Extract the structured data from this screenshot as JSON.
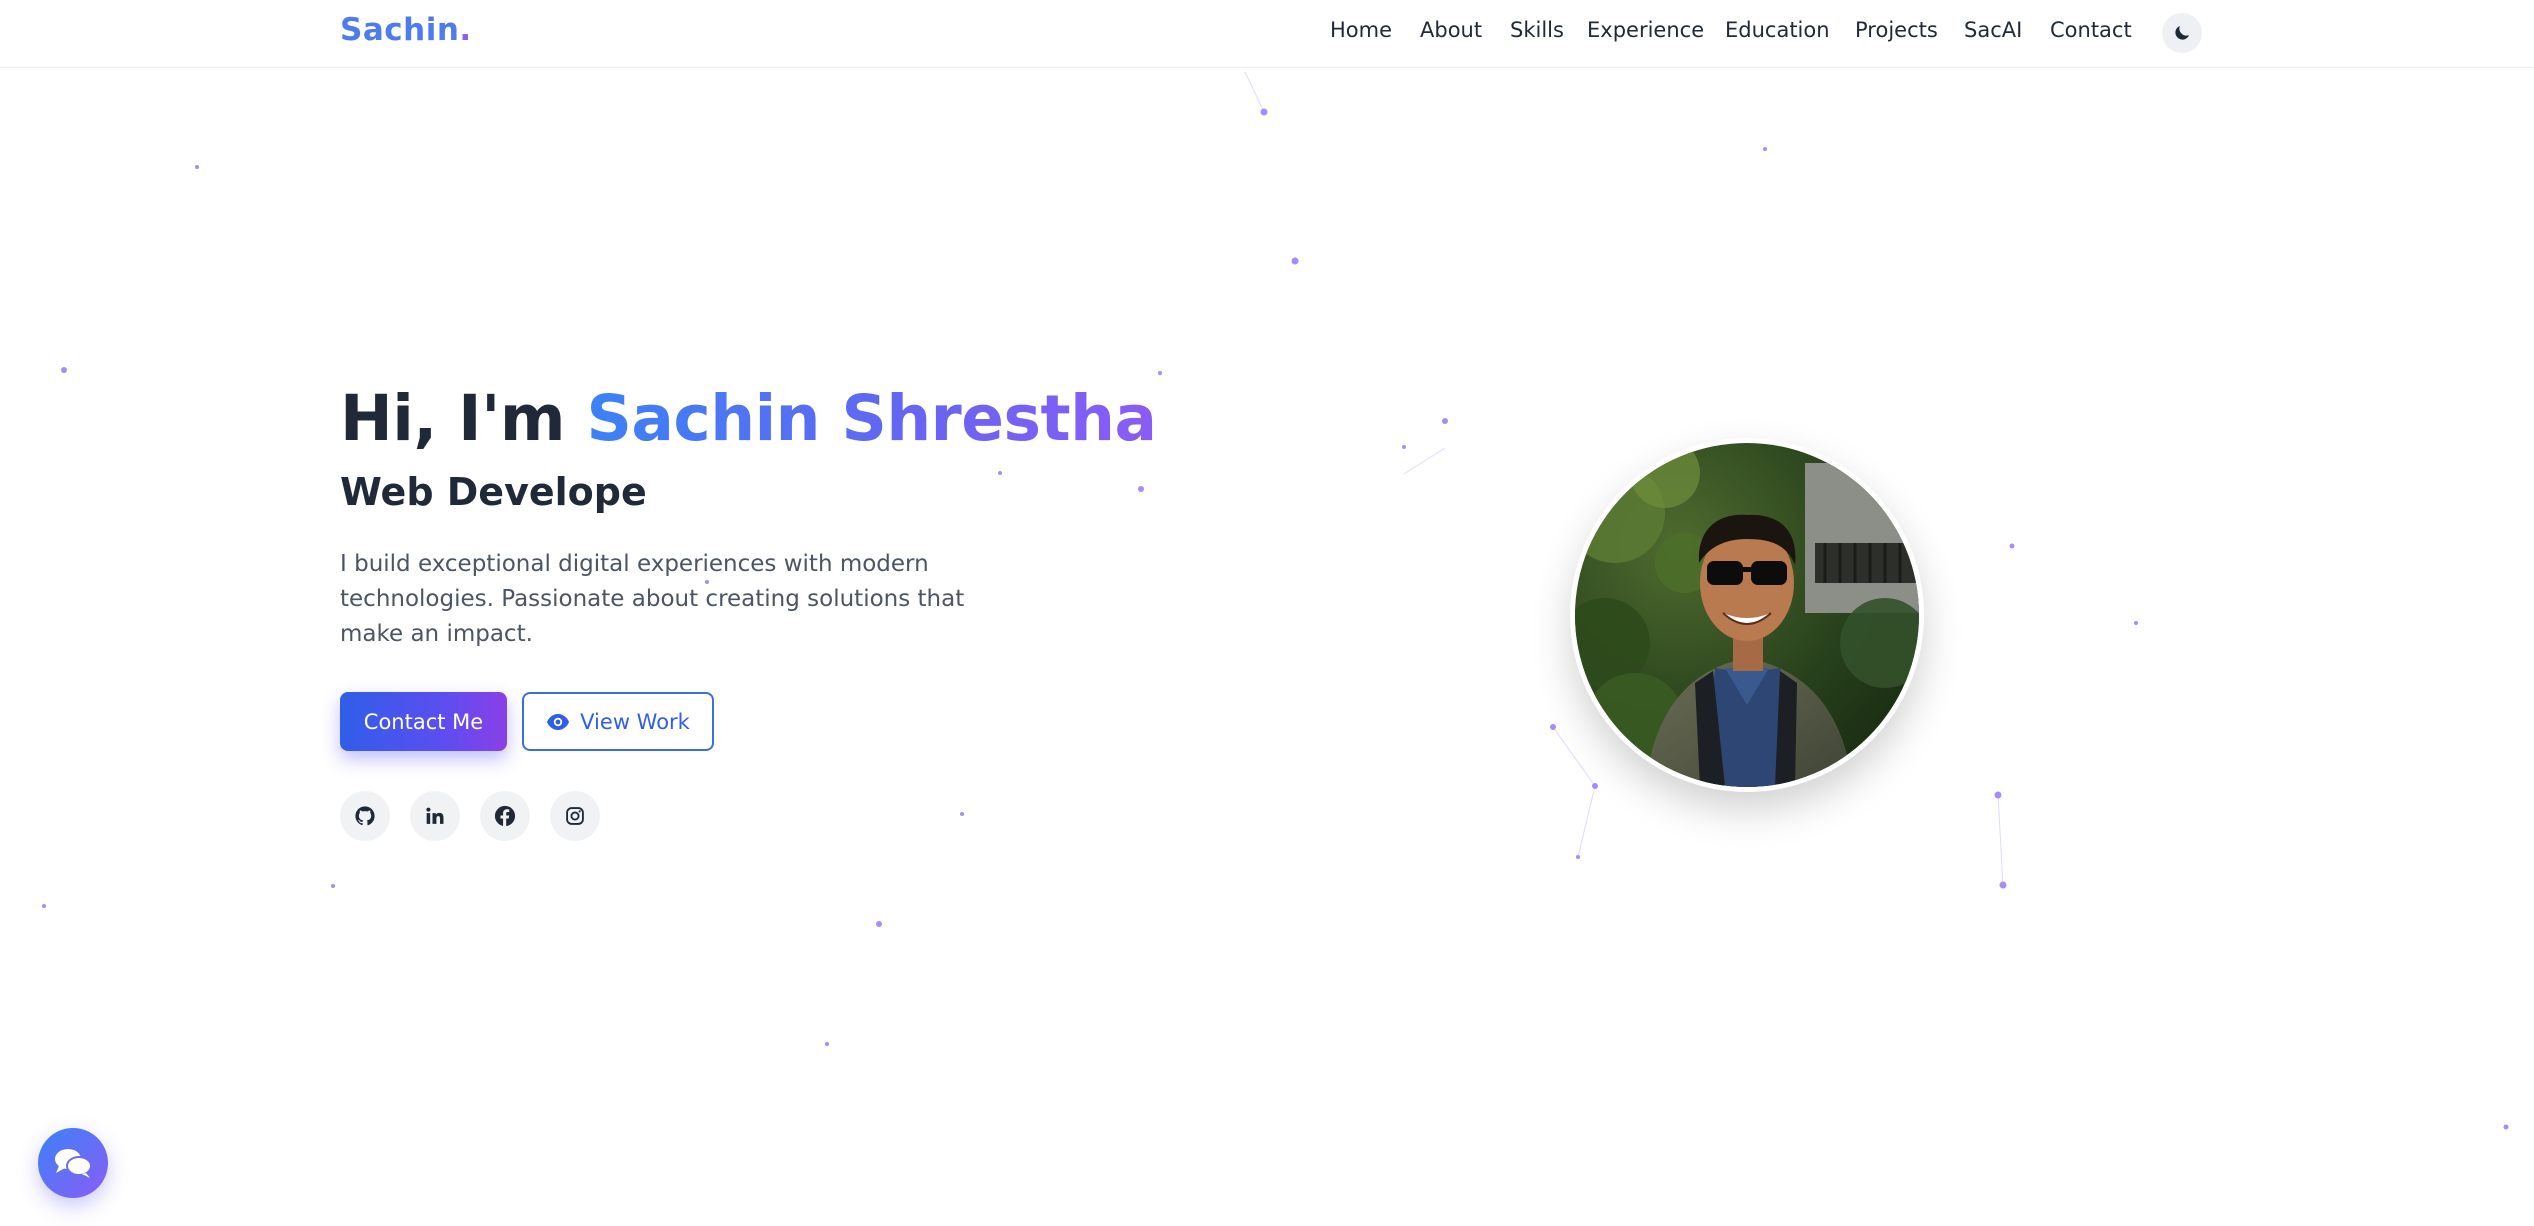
{
  "brand": {
    "name": "Sachin",
    "dot": "."
  },
  "nav": {
    "items": [
      "Home",
      "About",
      "Skills",
      "Experience",
      "Education",
      "Projects",
      "SacAI",
      "Contact"
    ],
    "theme_toggle_icon": "moon-icon"
  },
  "hero": {
    "greeting": "Hi, I'm ",
    "name": "Sachin Shrestha",
    "role": "Web Develope",
    "description": "I build exceptional digital experiences with modern technologies. Passionate about creating solutions that make an impact.",
    "primary_button": "Contact Me",
    "secondary_button": "View Work",
    "secondary_button_icon": "eye-icon",
    "social_icons": [
      "github-icon",
      "linkedin-icon",
      "facebook-icon",
      "instagram-icon"
    ]
  },
  "chat": {
    "icon": "chat-bubbles-icon"
  },
  "colors": {
    "brand": "#4f7bf0",
    "accent_blue": "#3b82f6",
    "accent_purple": "#8b5cf6",
    "text_dark": "#1f2937",
    "text_muted": "#4b5563"
  }
}
